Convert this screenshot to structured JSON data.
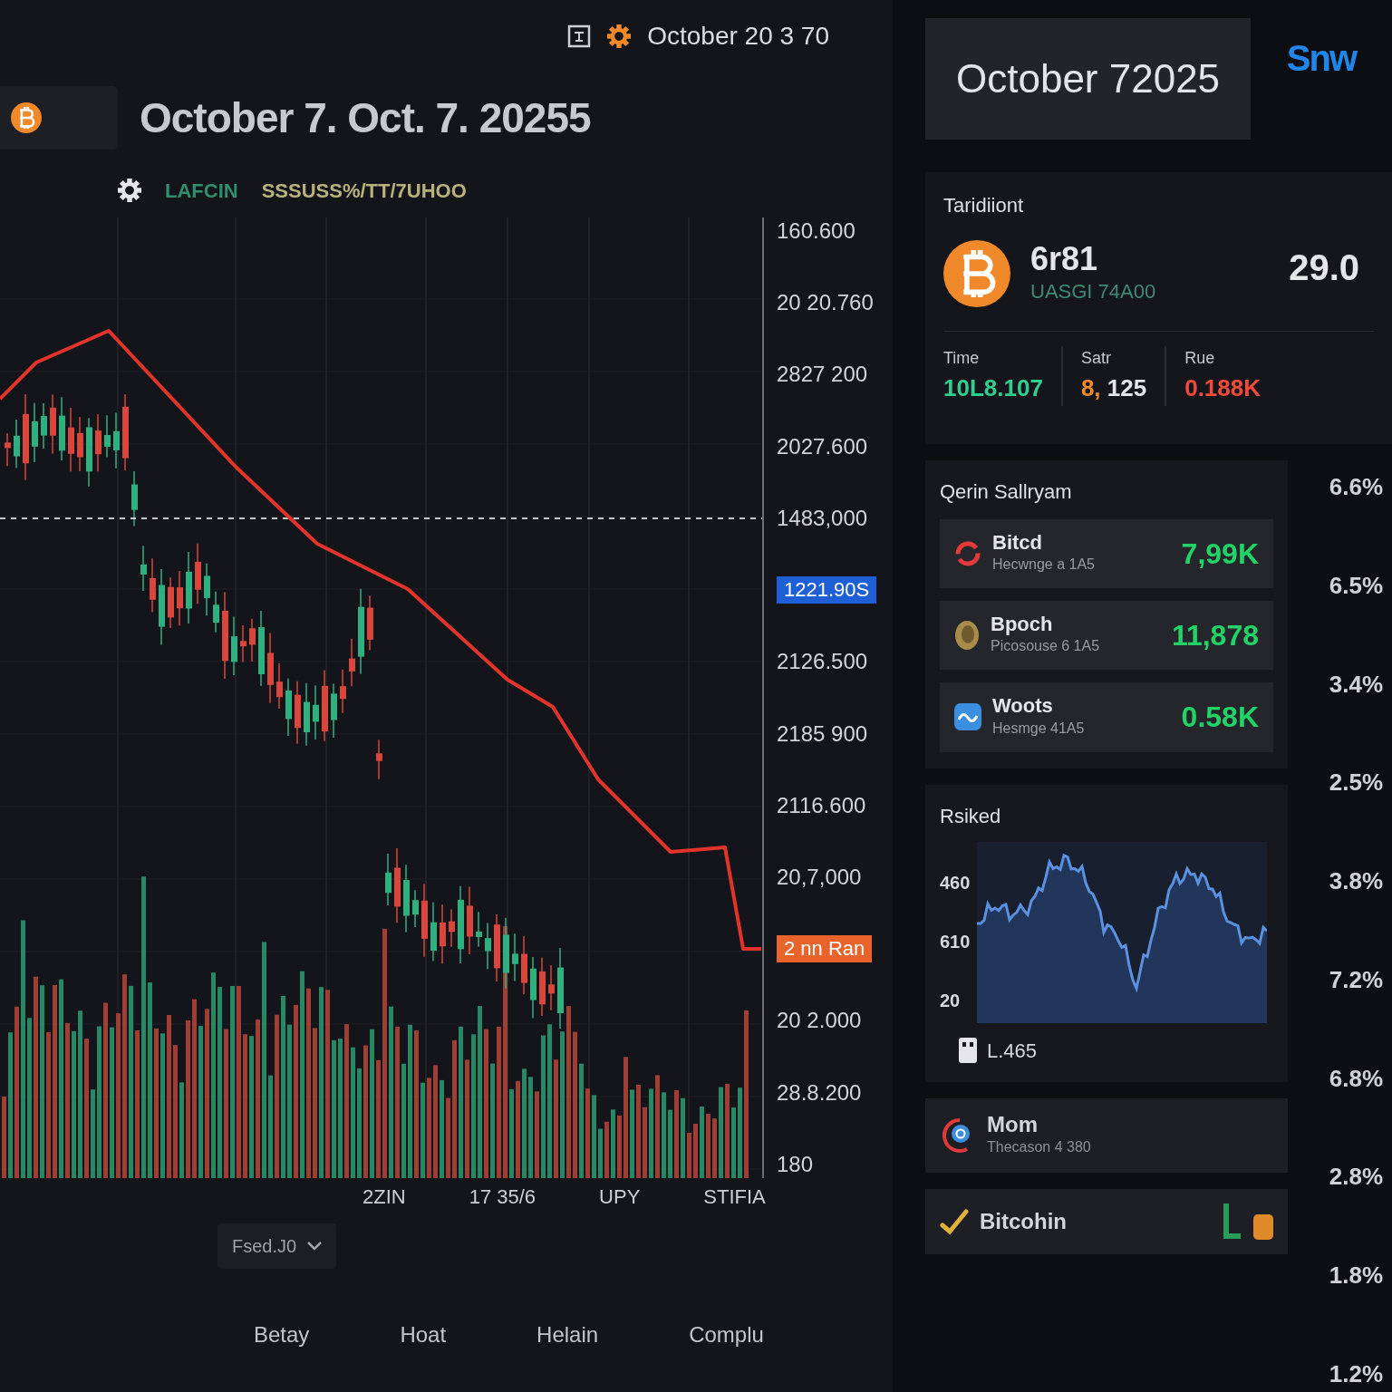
{
  "top_bar": {
    "date": "October 20 3 70"
  },
  "header": {
    "title": "October 7. Oct. 7. 20255"
  },
  "legend": [
    {
      "label": "LAFCIN",
      "color": "#2e8f6a"
    },
    {
      "label": "SSSUSS%/TT/7UHOO",
      "color": "#b9b27c"
    }
  ],
  "chart": {
    "y_labels": [
      {
        "kind": "tick",
        "text": "160.600"
      },
      {
        "kind": "tick",
        "text": "20 20.760"
      },
      {
        "kind": "tick",
        "text": "2827 200"
      },
      {
        "kind": "tick",
        "text": "2027.600"
      },
      {
        "kind": "tick",
        "text": "1483,000"
      },
      {
        "kind": "tag",
        "text": "1221.90S",
        "color": "#1f5fd6"
      },
      {
        "kind": "tick",
        "text": "2126.500"
      },
      {
        "kind": "tick",
        "text": "2185 900"
      },
      {
        "kind": "tick",
        "text": "2116.600"
      },
      {
        "kind": "tick",
        "text": "20,7,000"
      },
      {
        "kind": "tag",
        "text": "2 nn Ran",
        "color": "#e8642a"
      },
      {
        "kind": "tick",
        "text": "20 2.000"
      },
      {
        "kind": "tick",
        "text": "28.8.200"
      },
      {
        "kind": "tick",
        "text": "180"
      }
    ],
    "x_labels": [
      "2ZIN",
      "17 35/6",
      "UPY",
      "STIFIA"
    ]
  },
  "controls": {
    "dropdown": {
      "value": "Fsed.J0"
    }
  },
  "bottom_tabs": [
    "Betay",
    "Hoat",
    "Helain",
    "Complu"
  ],
  "side": {
    "title": "October 72025",
    "logo": "Snw",
    "summary": {
      "label": "Taridiiont",
      "coin_value": "6r81",
      "coin_sub": "UASGI 74A00",
      "side_value": "29.0",
      "stats": [
        {
          "label": "Time",
          "segments": [
            {
              "text": "10L8.107",
              "color": "#2fd08f"
            }
          ]
        },
        {
          "label": "Satr",
          "segments": [
            {
              "text": "8,",
              "color": "#f28b30"
            },
            {
              "text": "125",
              "color": "#e6e6ea"
            }
          ]
        },
        {
          "label": "Rue",
          "segments": [
            {
              "text": "0.188K",
              "color": "#f04a3a"
            }
          ]
        }
      ]
    },
    "watchlist": {
      "title": "Qerin Sallryam",
      "items": [
        {
          "kind": "ring",
          "name": "Bitcd",
          "sub": "Hecwnge a 1A5",
          "value": "7,99K"
        },
        {
          "kind": "medallion",
          "name": "Bpoch",
          "sub": "Picosouse 6 1A5",
          "value": "11,878"
        },
        {
          "kind": "tile",
          "name": "Woots",
          "sub": "Hesmge 41A5",
          "value": "0.58K"
        }
      ]
    },
    "activity": {
      "title": "Rsiked",
      "y_labels": [
        "460",
        "610",
        "20"
      ],
      "legend": "L.465"
    },
    "holdings": [
      {
        "kind": "target",
        "name": "Mom",
        "sub": "Thecason 4 380"
      },
      {
        "kind": "check",
        "name": "Bitcohin"
      }
    ],
    "percentages": [
      "6.6%",
      "6.5%",
      "3.4%",
      "2.5%",
      "3.8%",
      "7.2%",
      "6.8%",
      "2.8%",
      "1.8%",
      "1.2%"
    ]
  }
}
